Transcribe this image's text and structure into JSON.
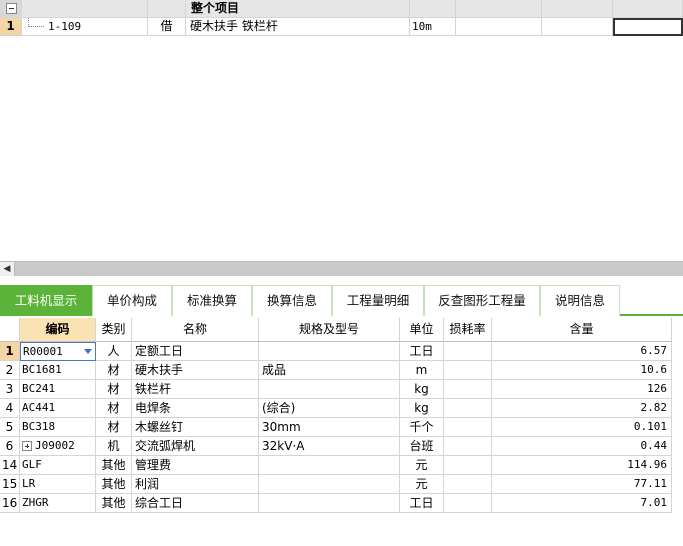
{
  "top_grid": {
    "header": {
      "title": "整个项目"
    },
    "rows": [
      {
        "num": "1",
        "code": "1-109",
        "type": "借",
        "name": "硬木扶手 铁栏杆",
        "unit": "10m"
      }
    ]
  },
  "tabs": [
    {
      "label": "工料机显示",
      "active": true
    },
    {
      "label": "单价构成"
    },
    {
      "label": "标准换算"
    },
    {
      "label": "换算信息"
    },
    {
      "label": "工程量明细"
    },
    {
      "label": "反查图形工程量"
    },
    {
      "label": "说明信息"
    }
  ],
  "bottom_table": {
    "headers": {
      "code": "编码",
      "category": "类别",
      "name": "名称",
      "spec": "规格及型号",
      "unit": "单位",
      "loss": "损耗率",
      "amount": "含量"
    },
    "rows": [
      {
        "idx": "1",
        "code": "R00001",
        "category": "人",
        "name": "定额工日",
        "spec": "",
        "unit": "工日",
        "loss": "",
        "amount": "6.57"
      },
      {
        "idx": "2",
        "code": "BC1681",
        "category": "材",
        "name": "硬木扶手",
        "spec": "成品",
        "unit": "m",
        "loss": "",
        "amount": "10.6"
      },
      {
        "idx": "3",
        "code": "BC241",
        "category": "材",
        "name": "铁栏杆",
        "spec": "",
        "unit": "kg",
        "loss": "",
        "amount": "126"
      },
      {
        "idx": "4",
        "code": "AC441",
        "category": "材",
        "name": "电焊条",
        "spec": "(综合)",
        "unit": "kg",
        "loss": "",
        "amount": "2.82"
      },
      {
        "idx": "5",
        "code": "BC318",
        "category": "材",
        "name": "木螺丝钉",
        "spec": "30mm",
        "unit": "千个",
        "loss": "",
        "amount": "0.101"
      },
      {
        "idx": "6",
        "code": "J09002",
        "category": "机",
        "name": "交流弧焊机",
        "spec": "32kV·A",
        "unit": "台班",
        "loss": "",
        "amount": "0.44"
      },
      {
        "idx": "14",
        "code": "GLF",
        "category": "其他",
        "name": "管理费",
        "spec": "",
        "unit": "元",
        "loss": "",
        "amount": "114.96"
      },
      {
        "idx": "15",
        "code": "LR",
        "category": "其他",
        "name": "利润",
        "spec": "",
        "unit": "元",
        "loss": "",
        "amount": "77.11"
      },
      {
        "idx": "16",
        "code": "ZHGR",
        "category": "其他",
        "name": "综合工日",
        "spec": "",
        "unit": "工日",
        "loss": "",
        "amount": "7.01"
      }
    ]
  },
  "colors": {
    "tab_active": "#5cb33a",
    "row_highlight": "#f4d6a5",
    "code_header": "#f9e3b3"
  }
}
